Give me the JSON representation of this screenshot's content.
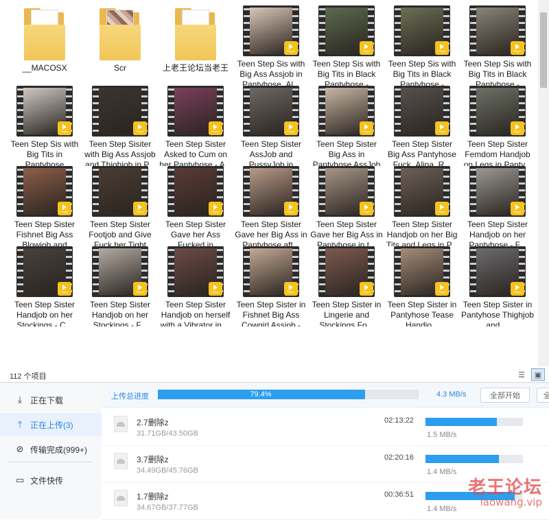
{
  "explorer": {
    "items": [
      {
        "type": "folder",
        "name": "__MACOSX",
        "paper": "plain"
      },
      {
        "type": "folder",
        "name": "Scr",
        "paper": "photo"
      },
      {
        "type": "folder",
        "name": "上老王论坛当老王",
        "paper": "plain"
      },
      {
        "type": "video",
        "name": "Teen Step Sis with Big Ass Assjob in Pantyhose_Al...",
        "tone": "#d9c6b6"
      },
      {
        "type": "video",
        "name": "Teen Step Sis with Big Tits in Black Pantyhose - Handjob, Cu...",
        "tone": "#5c6b4e"
      },
      {
        "type": "video",
        "name": "Teen Step Sis with Big Tits in Black Pantyhose - Handjob, Cu...",
        "tone": "#6b6f55"
      },
      {
        "type": "video",
        "name": "Teen Step Sis with Big Tits in Black Pantyhose - Handjob, Cu...",
        "tone": "#8a8378"
      },
      {
        "type": "video",
        "name": "Teen Step Sis with Big Tits in Pantyhose Femdom Han...",
        "tone": "#cfc8c2"
      },
      {
        "type": "video",
        "name": "Teen Step Sisiter with Big Ass Assjob and Thighjob in P...",
        "tone": "#3d3430"
      },
      {
        "type": "video",
        "name": "Teen Step Sister Asked to Cum on her Pantyhose - A...",
        "tone": "#7b3f5d"
      },
      {
        "type": "video",
        "name": "Teen Step Sister AssJob and PussyJob in Pantyhose_Ali...",
        "tone": "#6e6763"
      },
      {
        "type": "video",
        "name": "Teen Step Sister Big Ass in Pantyhose AssJob and F...",
        "tone": "#c7b6a3"
      },
      {
        "type": "video",
        "name": "Teen Step Sister Big Ass Pantyhose Fuck_Alina_R...",
        "tone": "#55514e"
      },
      {
        "type": "video",
        "name": "Teen Step Sister Femdom Handjob on Legs in Panty...",
        "tone": "#6c7266"
      },
      {
        "type": "video",
        "name": "Teen Step Sister Fishnet Big Ass Blowjob and Cowgirl - ...",
        "tone": "#8d5e4a"
      },
      {
        "type": "video",
        "name": "Teen Step Sister Footjob and Give Fuck her Tight Puss...",
        "tone": "#4b3d33"
      },
      {
        "type": "video",
        "name": "Teen Step Sister Gave her Ass Fucked in Pantyhose_Ali...",
        "tone": "#5a3b36"
      },
      {
        "type": "video",
        "name": "Teen Step Sister Gave her Big Ass in Pantyhose aft...",
        "tone": "#b89a88"
      },
      {
        "type": "video",
        "name": "Teen Step Sister Gave her Big Ass in Pantyhose in t...",
        "tone": "#a79687"
      },
      {
        "type": "video",
        "name": "Teen Step Sister Handjob on her Big Tits and Legs in P...",
        "tone": "#6d6058"
      },
      {
        "type": "video",
        "name": "Teen Step Sister Handjob on her Pantyhose - F...",
        "tone": "#9b9893"
      },
      {
        "type": "video",
        "name": "Teen Step Sister Handjob on her Stockings - C...",
        "tone": "#48413b"
      },
      {
        "type": "video",
        "name": "Teen Step Sister Handjob on her Stockings - F...",
        "tone": "#b3aaa2"
      },
      {
        "type": "video",
        "name": "Teen Step Sister Handjob on herself with a Vibrator in ...",
        "tone": "#6b4b46"
      },
      {
        "type": "video",
        "name": "Teen Step Sister in Fishnet Big Ass Cowgirl Assjob - Amat...",
        "tone": "#c3a894"
      },
      {
        "type": "video",
        "name": "Teen Step Sister in Lingerie and Stockings Fo...",
        "tone": "#7d5a4f"
      },
      {
        "type": "video",
        "name": "Teen Step Sister in Pantyhose Tease Handjo...",
        "tone": "#a58c78"
      },
      {
        "type": "video",
        "name": "Teen Step Sister in Pantyhose Thighjob and ...",
        "tone": "#6d6b6e"
      }
    ],
    "play_badge_text": "Player",
    "status_count": "112 个项目",
    "view_details_icon": "details-view-icon",
    "view_large_icon": "large-icons-view-icon"
  },
  "netdisk": {
    "nav": [
      {
        "label": "正在下载",
        "icon": "download-icon",
        "active": false
      },
      {
        "label": "正在上传(3)",
        "icon": "upload-icon",
        "active": true
      },
      {
        "label": "传输完成(999+)",
        "icon": "check-circle-icon",
        "active": false
      },
      {
        "label": "文件快传",
        "icon": "monitor-icon",
        "active": false
      }
    ],
    "summary": {
      "label": "上传总进度",
      "progress_text": "79.4%",
      "progress": 0.794,
      "speed": "4.3 MB/s",
      "start_all": "全部开始",
      "clipped_btn": "全"
    },
    "tasks": [
      {
        "name": "2.7删除z",
        "size": "31.71GB/43.50GB",
        "time": "02:13:22",
        "progress": 0.729,
        "speed": "1.5 MB/s"
      },
      {
        "name": "3.7删除z",
        "size": "34.49GB/45.76GB",
        "time": "02:20:16",
        "progress": 0.754,
        "speed": "1.4 MB/s"
      },
      {
        "name": "1.7删除z",
        "size": "34.67GB/37.77GB",
        "time": "00:36:51",
        "progress": 0.918,
        "speed": "1.4 MB/s"
      }
    ]
  },
  "watermark": {
    "line1": "老王论坛",
    "line2": "laowang.vip"
  },
  "colors": {
    "accent": "#2b9ef0",
    "badge": "#f6c21b",
    "folder": "#f1c659"
  }
}
